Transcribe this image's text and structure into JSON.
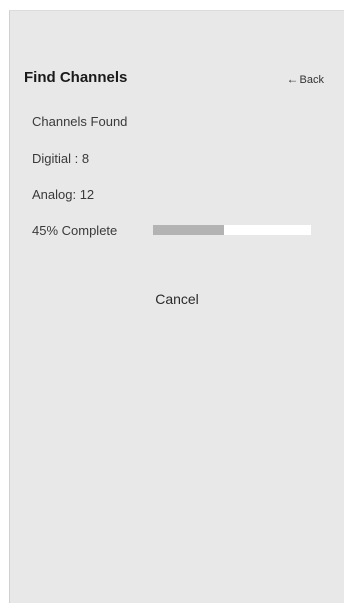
{
  "header": {
    "title": "Find Channels",
    "back_label": "Back",
    "back_icon": "left-arrow-icon"
  },
  "scan": {
    "heading": "Channels Found",
    "digital_text": "Digitial : 8",
    "analog_text": "Analog: 12",
    "progress_text": "45% Complete",
    "progress_value": 0.45
  },
  "actions": {
    "cancel_label": "Cancel"
  },
  "colors": {
    "background": "#e8e8e8",
    "progress_fill": "#b3b3b3",
    "progress_track": "#ffffff"
  }
}
